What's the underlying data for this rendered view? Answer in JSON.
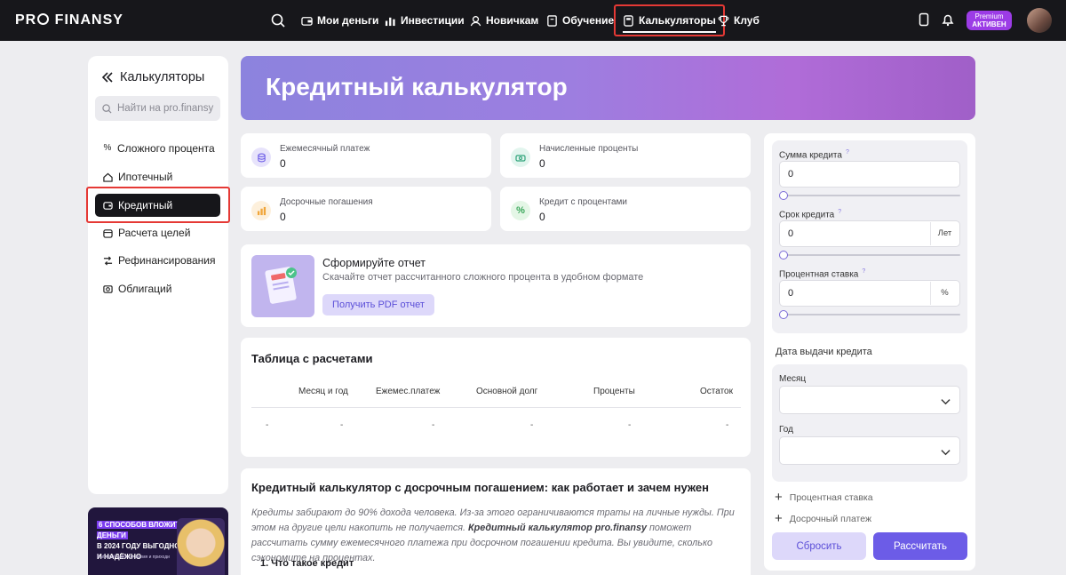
{
  "topbar": {
    "logo": "PRO FINANSY",
    "nav": [
      {
        "label": "Мои деньги",
        "icon": "wallet-icon"
      },
      {
        "label": "Инвестиции",
        "icon": "bar-chart-icon"
      },
      {
        "label": "Новичкам",
        "icon": "newcomer-icon"
      },
      {
        "label": "Обучение",
        "icon": "book-icon"
      },
      {
        "label": "Калькуляторы",
        "icon": "calculator-icon",
        "active": true
      },
      {
        "label": "Клуб",
        "icon": "trophy-icon"
      }
    ],
    "premium_line1": "Premium",
    "premium_line2": "АКТИВЕН"
  },
  "sidebar": {
    "title": "Калькуляторы",
    "search_placeholder": "Найти на pro.finansy",
    "items": [
      {
        "label": "Сложного процента",
        "icon": "percent-icon"
      },
      {
        "label": "Ипотечный",
        "icon": "house-icon"
      },
      {
        "label": "Кредитный",
        "icon": "card-icon",
        "active": true
      },
      {
        "label": "Расчета целей",
        "icon": "calendar-icon"
      },
      {
        "label": "Рефинансирования",
        "icon": "refinance-icon"
      },
      {
        "label": "Облигаций",
        "icon": "bond-icon"
      }
    ]
  },
  "promo": {
    "title_line1": "6 СПОСОБОВ ВЛОЖИТЬ ДЕНЬГИ",
    "title_line2": "В 2024 ГОДУ ВЫГОДНО",
    "title_line3": "И НАДЁЖНО",
    "subtitle": "Выберай удобное время и приходи"
  },
  "hero": {
    "title": "Кредитный калькулятор"
  },
  "stats": [
    {
      "label": "Ежемесячный платеж",
      "value": "0",
      "icon": "coins-icon",
      "color": "#e7e3fb"
    },
    {
      "label": "Начисленные проценты",
      "value": "0",
      "icon": "money-icon",
      "color": "#e2f5ee"
    },
    {
      "label": "Досрочные погашения",
      "value": "0",
      "icon": "bars-icon",
      "color": "#fdf0dc"
    },
    {
      "label": "Кредит с процентами",
      "value": "0",
      "icon": "percent-icon",
      "color": "#e4f6e6"
    }
  ],
  "report": {
    "title": "Сформируйте отчет",
    "text": "Скачайте отчет рассчитанного сложного процента в удобном формате",
    "button": "Получить PDF отчет"
  },
  "table": {
    "title": "Таблица с расчетами",
    "headers": [
      "Месяц и год",
      "Ежемес.платеж",
      "Основной долг",
      "Проценты",
      "Остаток"
    ],
    "row": [
      "-",
      "-",
      "-",
      "-",
      "-",
      "-"
    ]
  },
  "article": {
    "title": "Кредитный калькулятор с досрочным погашением: как работает и зачем нужен",
    "p1": "Кредиты забирают до 90% дохода человека. Из-за этого ограничиваются траты на личные нужды. При этом на другие цели накопить не получается. ",
    "p_bold": "Кредитный калькулятор pro.finansy",
    "p2": " поможет рассчитать сумму ежемесячного платежа при досрочном погашении кредита. Вы увидите, сколько сэкономите на процентах.",
    "list1": "1. Что такое кредит"
  },
  "form": {
    "amount_label": "Сумма кредита",
    "amount_value": "0",
    "term_label": "Срок кредита",
    "term_value": "0",
    "term_unit": "Лет",
    "rate_label": "Процентная ставка",
    "rate_value": "0",
    "rate_unit": "%",
    "hint_mark": "?",
    "slider_level": 0,
    "date_label": "Дата выдачи кредита",
    "month_label": "Месяц",
    "year_label": "Год",
    "add_rate": "Процентная ставка",
    "add_payment": "Досрочный платеж",
    "reset": "Сбросить",
    "calculate": "Рассчитать",
    "accent": "#6c5ce7"
  }
}
